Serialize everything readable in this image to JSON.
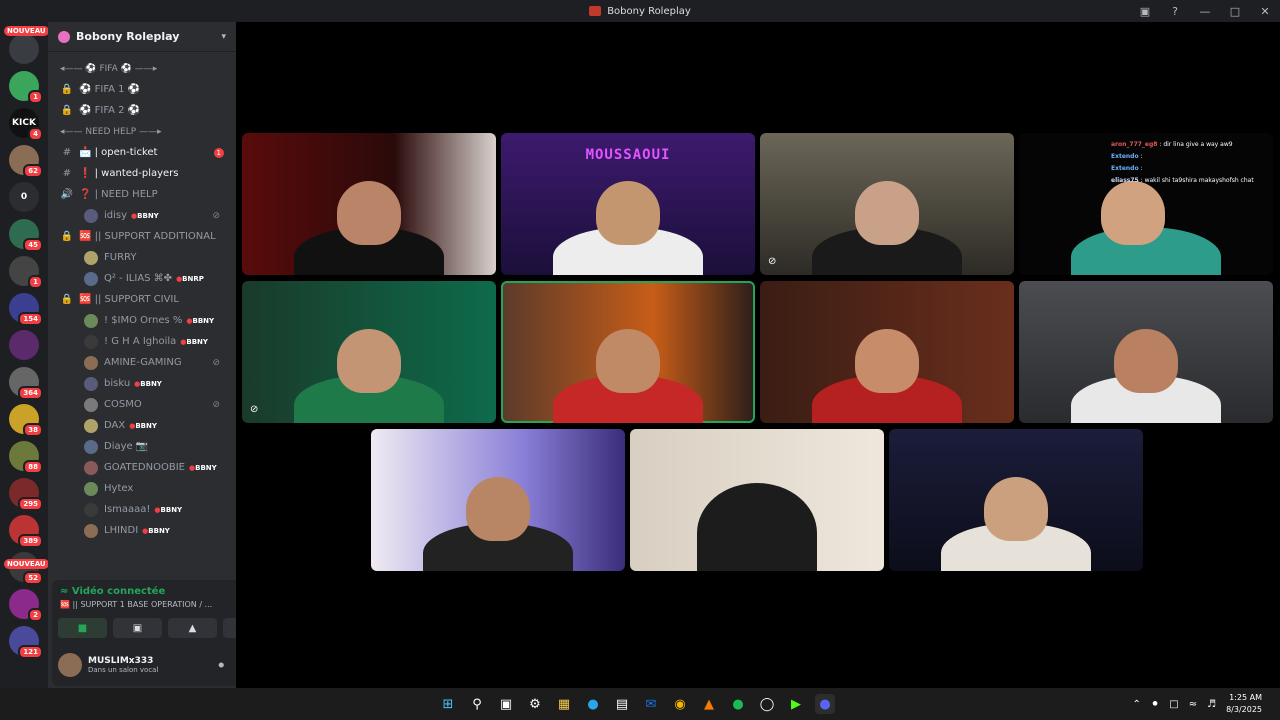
{
  "window": {
    "title": "Bobony Roleplay"
  },
  "rail": {
    "nouveau_label": "NOUVEAU",
    "servers": [
      {
        "icon": "music-note-icon",
        "label": "",
        "badge": "",
        "color": "#3a3c43"
      },
      {
        "icon": "money-icon",
        "label": "",
        "badge": "1",
        "color": "#3ba55c"
      },
      {
        "icon": "kick-logo-icon",
        "label": "KICK",
        "badge": "4",
        "color": "#111"
      },
      {
        "icon": "avatar-icon",
        "label": "",
        "badge": "62",
        "color": "#8a6d54"
      },
      {
        "icon": "letter-icon",
        "label": "0",
        "badge": "",
        "color": "#2b2d31"
      },
      {
        "icon": "server-icon",
        "label": "",
        "badge": "45",
        "color": "#2f6b4f"
      },
      {
        "icon": "server-icon",
        "label": "",
        "badge": "1",
        "color": "#444"
      },
      {
        "icon": "server-icon",
        "label": "",
        "badge": "154",
        "color": "#3b3f8f"
      },
      {
        "icon": "server-icon",
        "label": "",
        "badge": "",
        "color": "#5a2a6b"
      },
      {
        "icon": "server-icon",
        "label": "",
        "badge": "364",
        "color": "#666"
      },
      {
        "icon": "server-icon",
        "label": "",
        "badge": "38",
        "color": "#c9a227"
      },
      {
        "icon": "server-icon",
        "label": "",
        "badge": "88",
        "color": "#6b7a3a"
      },
      {
        "icon": "server-icon",
        "label": "",
        "badge": "295",
        "color": "#7a2a2a"
      },
      {
        "icon": "server-icon",
        "label": "",
        "badge": "389",
        "color": "#b33"
      },
      {
        "icon": "server-icon",
        "label": "",
        "badge": "52",
        "color": "#3a3a3a"
      },
      {
        "icon": "server-icon",
        "label": "",
        "badge": "2",
        "color": "#8b2a8b"
      },
      {
        "icon": "server-icon",
        "label": "",
        "badge": "121",
        "color": "#4a4a9a"
      }
    ]
  },
  "sidebar": {
    "server_name": "Bobony Roleplay",
    "channels": [
      {
        "kind": "cat",
        "label": "◂—— ⚽ FIFA ⚽ ——▸"
      },
      {
        "kind": "voice-locked",
        "label": "⚽ FIFA 1 ⚽"
      },
      {
        "kind": "voice-locked",
        "label": "⚽ FIFA 2 ⚽"
      },
      {
        "kind": "cat",
        "label": "◂—— NEED HELP ——▸"
      },
      {
        "kind": "text",
        "label": "📩 | open-ticket",
        "mention": "1"
      },
      {
        "kind": "text",
        "label": "❗ | wanted-players"
      },
      {
        "kind": "voice",
        "label": "❓ | NEED HELP"
      },
      {
        "kind": "user",
        "label": "idisy",
        "tag": "BBNY",
        "muted": true
      },
      {
        "kind": "voice-locked",
        "label": "🆘 || SUPPORT ADDITIONAL"
      },
      {
        "kind": "user",
        "label": "FURRY",
        "tag": ""
      },
      {
        "kind": "user",
        "label": "Q² - ILIAS ⌘✤",
        "tag": "BNRP"
      },
      {
        "kind": "voice-locked",
        "label": "🆘 || SUPPORT CIVIL"
      },
      {
        "kind": "user",
        "label": "! $IMO Ornes %",
        "tag": "BBNY"
      },
      {
        "kind": "user",
        "label": "! G H A Ighoila",
        "tag": "BBNY"
      },
      {
        "kind": "user",
        "label": "AMINE-GAMING",
        "tag": "",
        "muted": true
      },
      {
        "kind": "user",
        "label": "bisku",
        "tag": "BBNY"
      },
      {
        "kind": "user",
        "label": "COSMO",
        "tag": "",
        "muted": true
      },
      {
        "kind": "user",
        "label": "DAX",
        "tag": "BBNY"
      },
      {
        "kind": "user",
        "label": "Diaye 📷",
        "tag": ""
      },
      {
        "kind": "user",
        "label": "GOATEDNOOBIE",
        "tag": "BBNY"
      },
      {
        "kind": "user",
        "label": "Hytex",
        "tag": ""
      },
      {
        "kind": "user",
        "label": "Ismaaaa!",
        "tag": "BBNY"
      },
      {
        "kind": "user",
        "label": "LHINDI",
        "tag": "BBNY"
      }
    ]
  },
  "voice": {
    "status": "Vidéo connectée",
    "channel": "🆘 || SUPPORT 1 BASE OPERATION / ..."
  },
  "user": {
    "name": "MUSLIMx333",
    "status": "Dans un salon vocal"
  },
  "stage": {
    "neon_text": "MOUSSAOUI",
    "chat": [
      {
        "user": "aron_777_eg8",
        "text": ": dir lina give a way aw9",
        "color": "#e05a5a"
      },
      {
        "user": "Extendo",
        "text": ":",
        "color": "#6ab0ff"
      },
      {
        "user": "Extendo",
        "text": ":",
        "color": "#6ab0ff"
      },
      {
        "user": "eliass75",
        "text": ": wakil shi ta9shira makayshofsh chat",
        "color": "#cfd8ff"
      }
    ]
  },
  "taskbar": {
    "time": "1:25 AM",
    "date": "8/3/2025"
  }
}
